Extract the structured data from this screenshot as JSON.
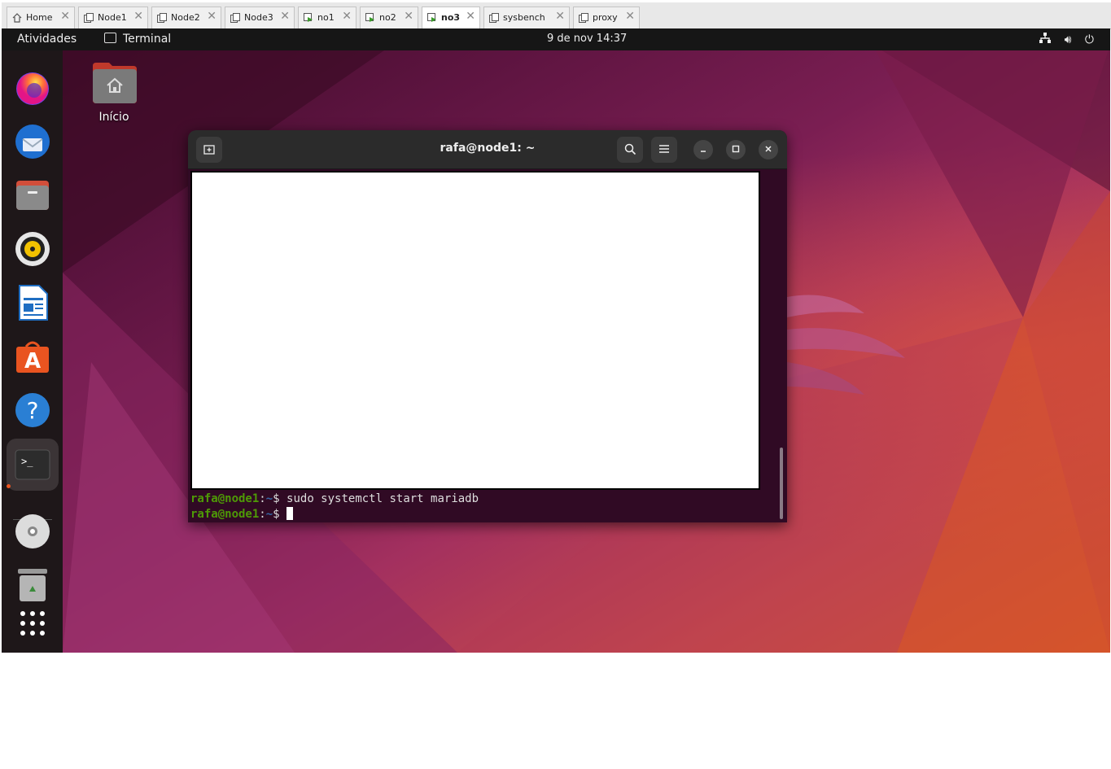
{
  "tabs": [
    {
      "label": "Home",
      "icon": "home-icon",
      "active": false
    },
    {
      "label": "Node1",
      "icon": "vm-icon",
      "active": false
    },
    {
      "label": "Node2",
      "icon": "vm-icon",
      "active": false
    },
    {
      "label": "Node3",
      "icon": "vm-icon",
      "active": false
    },
    {
      "label": "no1",
      "icon": "vm-running-icon",
      "active": false
    },
    {
      "label": "no2",
      "icon": "vm-running-icon",
      "active": false
    },
    {
      "label": "no3",
      "icon": "vm-running-icon",
      "active": true
    },
    {
      "label": "sysbench",
      "icon": "vm-icon",
      "active": false
    },
    {
      "label": "proxy",
      "icon": "vm-icon",
      "active": false
    }
  ],
  "topbar": {
    "activities": "Atividades",
    "app_name": "Terminal",
    "clock": "9 de nov  14:37"
  },
  "desktop": {
    "home_label": "Início"
  },
  "dock": [
    {
      "name": "firefox-icon"
    },
    {
      "name": "thunderbird-icon"
    },
    {
      "name": "files-icon"
    },
    {
      "name": "rhythmbox-icon"
    },
    {
      "name": "libreoffice-writer-icon"
    },
    {
      "name": "app-center-icon"
    },
    {
      "name": "help-icon"
    },
    {
      "name": "terminal-icon"
    },
    {
      "name": "dvd-icon"
    },
    {
      "name": "trash-icon"
    },
    {
      "name": "show-apps-icon"
    }
  ],
  "terminal": {
    "title": "rafa@node1: ~",
    "prompt_user": "rafa@node1",
    "prompt_sep": ":",
    "prompt_path": "~",
    "prompt_sign": "$ ",
    "line1_command": "sudo systemctl start mariadb",
    "line2_command": ""
  },
  "colors": {
    "terminal_bg": "#300a24",
    "prompt_green": "#4e9a06",
    "accent": "#e95420"
  }
}
